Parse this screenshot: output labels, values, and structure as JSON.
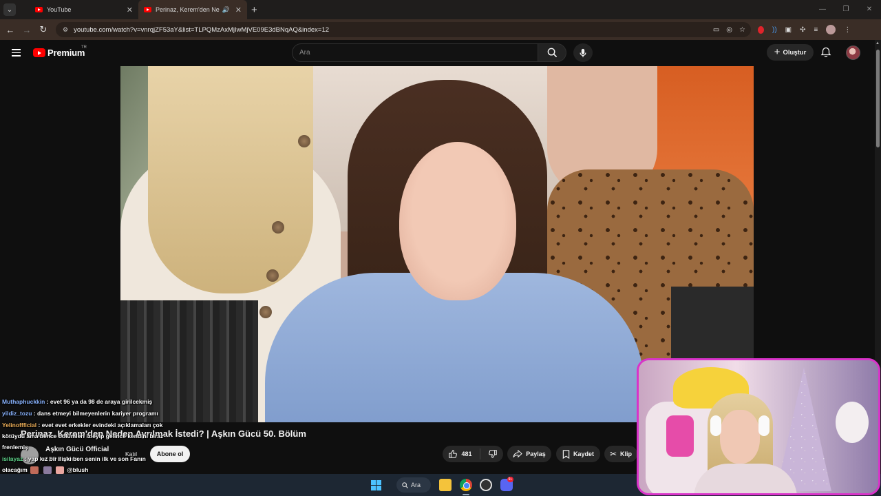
{
  "browser": {
    "tabs": [
      {
        "title": "YouTube",
        "active": false
      },
      {
        "title": "Perinaz, Kerem'den Neden Ayrılmak İstedi? | Aşkın Gücü 50. Bölüm",
        "active": true
      }
    ],
    "url": "youtube.com/watch?v=vnrqjZF53aY&list=TLPQMzAxMjIwMjVE09E3dBNqAQ&index=12"
  },
  "masthead": {
    "logo_text": "Premium",
    "region": "TR",
    "search_placeholder": "Ara",
    "create_label": "Oluştur"
  },
  "chat": [
    {
      "user": "Muthaphuckkin",
      "text": ": evet 96 ya da 98 de araya girilcekmiş"
    },
    {
      "user": "yildiz_tozu",
      "text": ": dans etmeyi bilmeyenlerin kariyer programı"
    },
    {
      "user": "Yelinoffficial",
      "text": ": evet evet erkekler evindeki açıklamaları çok kötüydü ama bence bölümleri izleyip gelince kendini biraz frenlemiş"
    },
    {
      "user": "isilayaz",
      "text": ": yap kız bir ilişki ben senin ilk ve son Fanın olacağım",
      "suffix": "@blush"
    }
  ],
  "video": {
    "title": "Perinaz, Kerem'den Neden Ayrılmak İstedi? | Aşkın Gücü 50. Bölüm",
    "channel": "Aşkın Gücü Official",
    "subscribers": "1,93 B abone",
    "join_label": "Katıl",
    "subscribe_label": "Abone ol",
    "likes": "481",
    "share_label": "Paylaş",
    "save_label": "Kaydet",
    "clip_label": "Klip"
  },
  "taskbar": {
    "search_label": "Ara",
    "discord_badge": "9+"
  },
  "colors": {
    "youtube_red": "#ff0000",
    "webcam_border": "#d933c9",
    "taskbar_bg": "#1d2733"
  }
}
